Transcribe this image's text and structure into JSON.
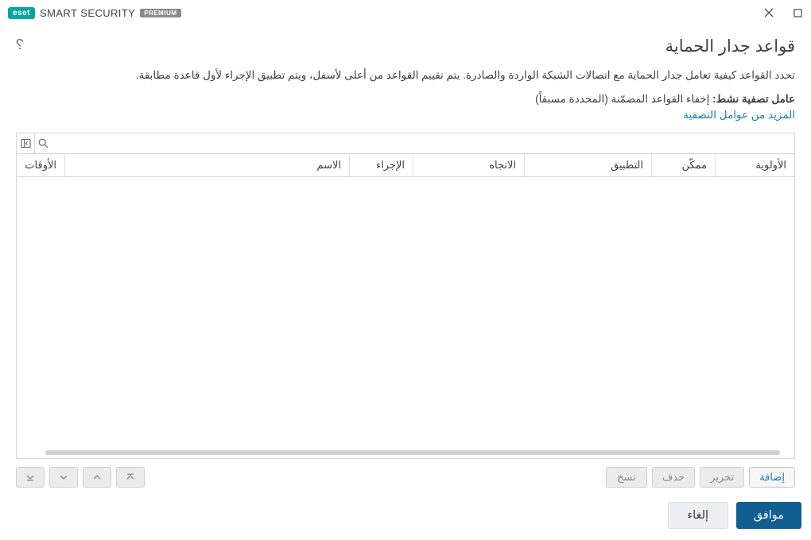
{
  "brand": {
    "badge": "eset",
    "name_smart": "SMART",
    "name_security": "SECURITY",
    "premium": "PREMIUM"
  },
  "header": {
    "title": "قواعد جدار الحماية",
    "description": "تحدد القواعد كيفية تعامل جدار الحماية مع اتصالات الشبكة الواردة والصادرة. يتم تقييم القواعد من أعلى لأسفل، ويتم تطبيق الإجراء لأول قاعدة مطابقة.",
    "filter_label": "عامل تصفية نشط:",
    "filter_value": "إخفاء القواعد المضمّنة (المحددة مسبقاً)",
    "more_filters": "المزيد من عوامل التصفية"
  },
  "table": {
    "columns": {
      "priority": "الأولوية",
      "enabled": "ممكّن",
      "app": "التطبيق",
      "direction": "الاتجاه",
      "action": "الإجراء",
      "name": "الاسم",
      "times": "الأوقات"
    }
  },
  "row_buttons": {
    "add": "إضافة",
    "edit": "تحرير",
    "delete": "حذف",
    "copy": "نسخ"
  },
  "footer": {
    "ok": "موافق",
    "cancel": "إلغاء"
  }
}
